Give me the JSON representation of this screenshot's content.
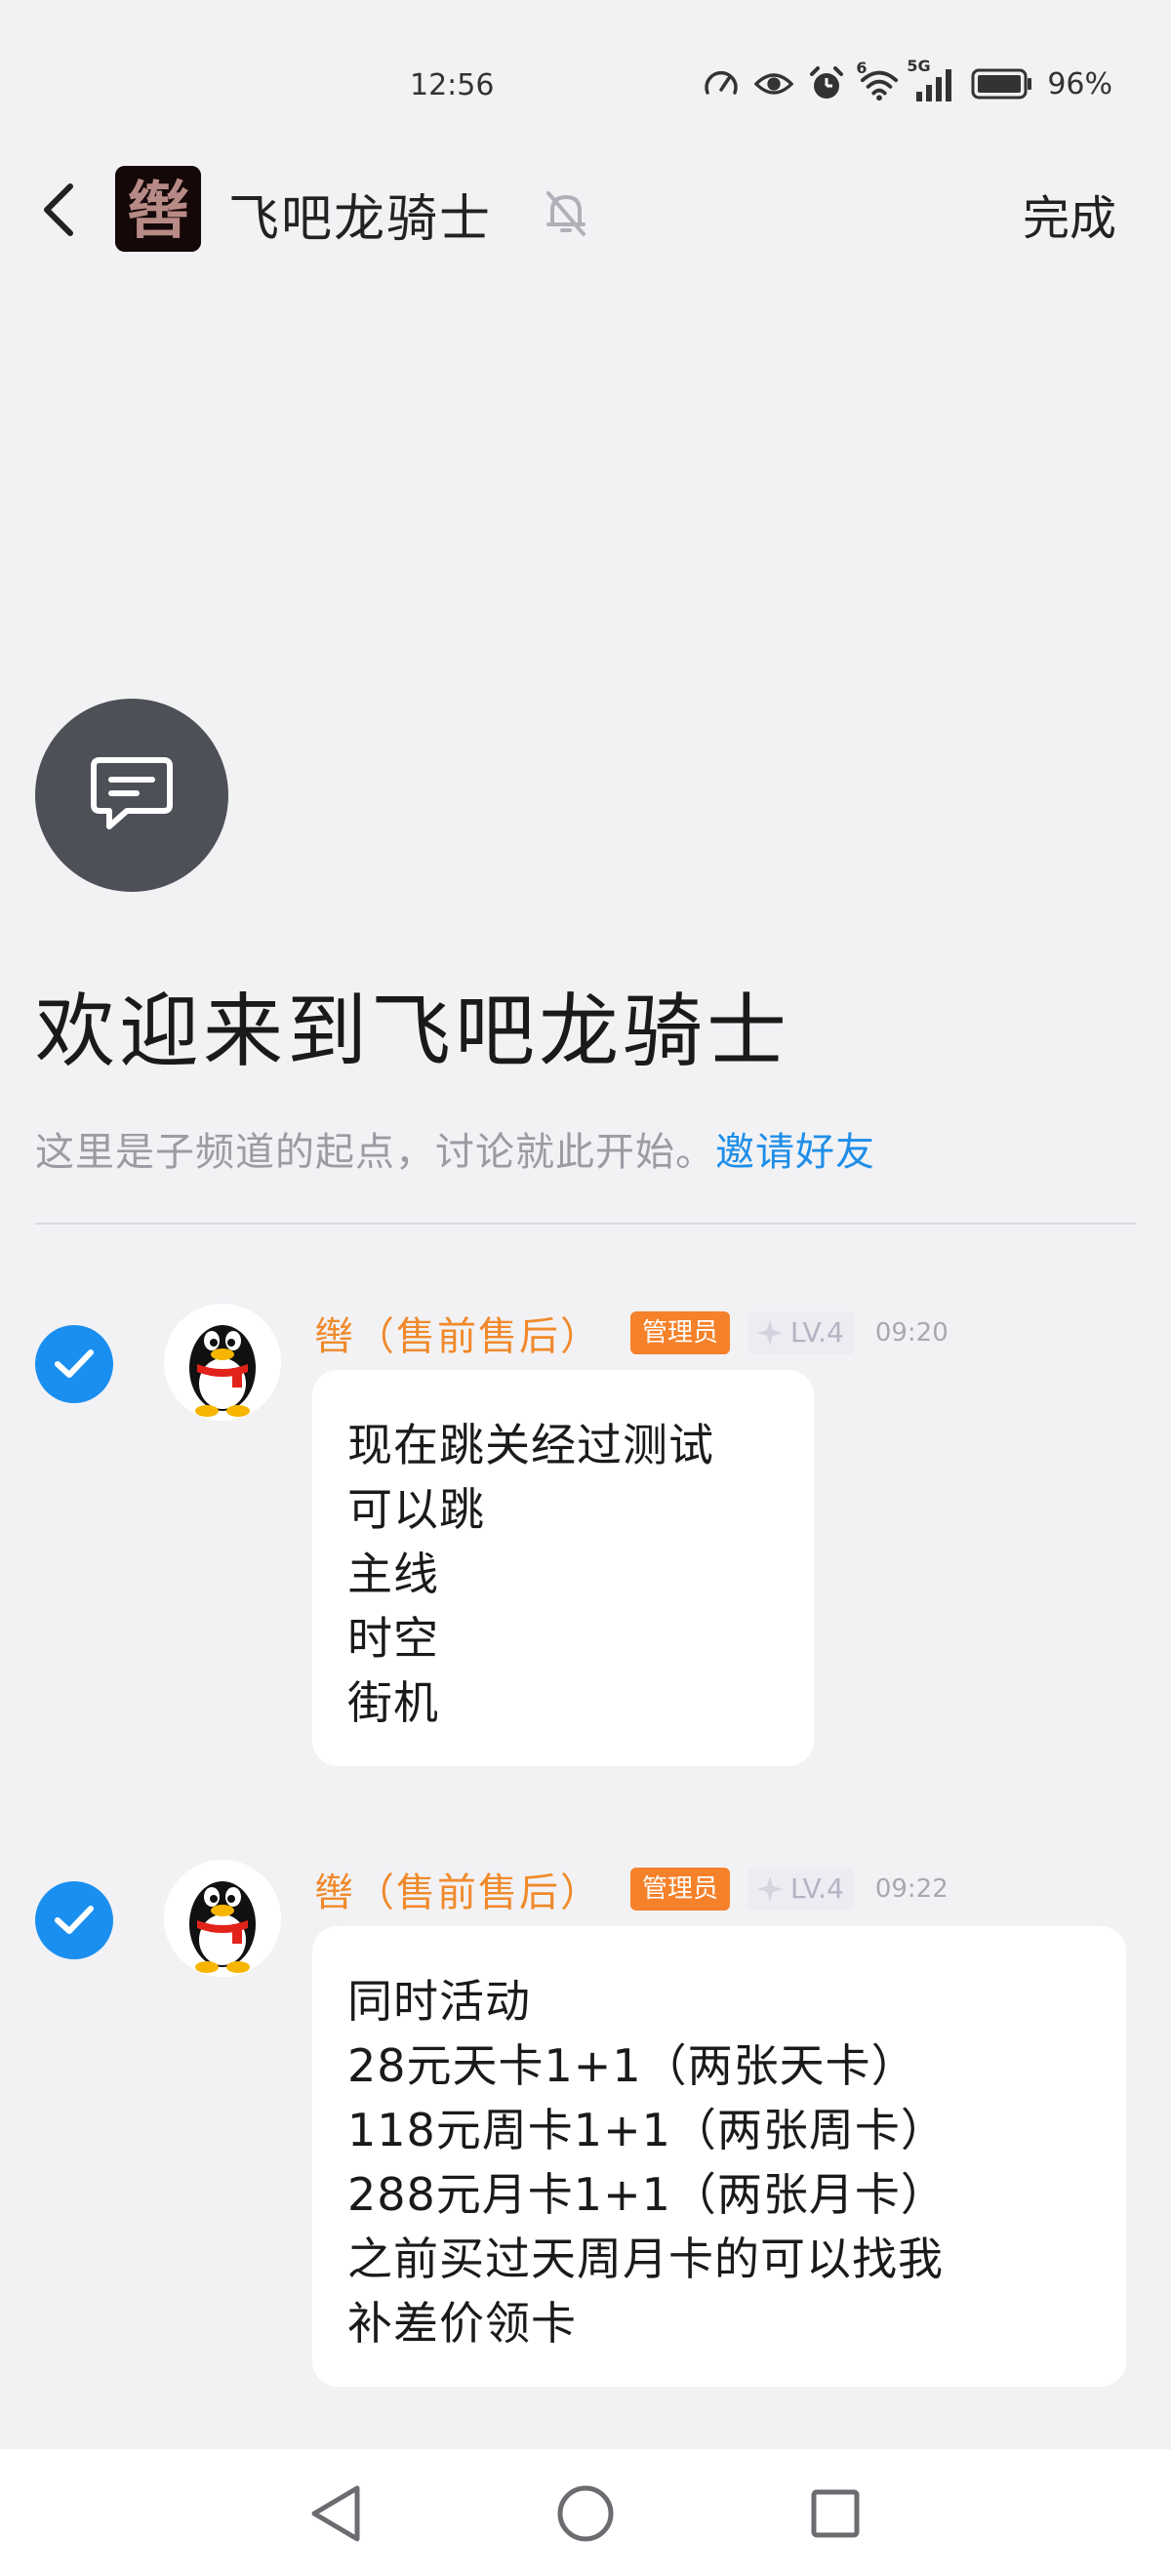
{
  "status_bar": {
    "time": "12:56",
    "battery_percent": "96%",
    "network": "5G",
    "wifi_badge": "6",
    "icons": [
      "speedometer-icon",
      "eye-icon",
      "alarm-icon",
      "wifi-icon",
      "signal-icon",
      "battery-icon"
    ]
  },
  "header": {
    "title": "飞吧龙骑士",
    "done_label": "完成",
    "avatar_char": "辔",
    "muted": true
  },
  "welcome": {
    "title": "欢迎来到飞吧龙骑士",
    "subtitle": "这里是子频道的起点，讨论就此开始。",
    "invite_label": "邀请好友"
  },
  "messages": [
    {
      "sender": "辔（售前售后）",
      "role": "管理员",
      "level": "LV.4",
      "time": "09:20",
      "selected": true,
      "lines": [
        "现在跳关经过测试",
        "可以跳",
        "主线",
        "时空",
        "街机"
      ]
    },
    {
      "sender": "辔（售前售后）",
      "role": "管理员",
      "level": "LV.4",
      "time": "09:22",
      "selected": true,
      "lines": [
        "同时活动",
        "28元天卡1+1（两张天卡）",
        "118元周卡1+1（两张周卡）",
        "288元月卡1+1（两张月卡）",
        "之前买过天周月卡的可以找我",
        "补差价领卡"
      ]
    }
  ],
  "colors": {
    "accent_blue": "#1a8ff0",
    "sender_orange": "#f08a2c",
    "badge_orange": "#f5812a",
    "link_blue": "#1f8ee8",
    "background": "#f2f2f5"
  }
}
